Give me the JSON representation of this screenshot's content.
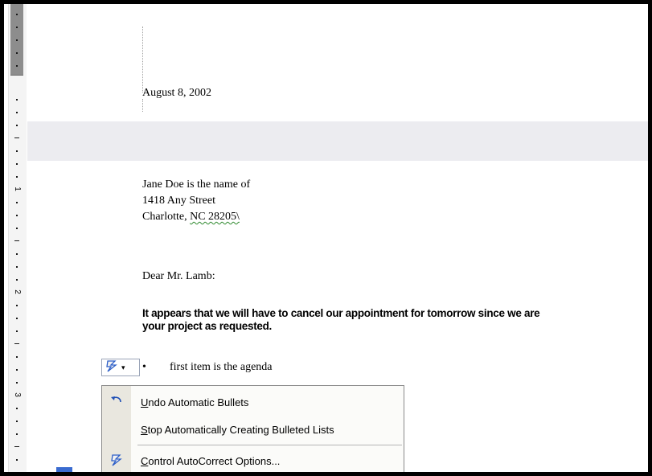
{
  "document": {
    "date": "August 8, 2002",
    "address": [
      "Jane Doe is the name of",
      "1418 Any Street",
      "Charlotte, NC  28205\\"
    ],
    "salutation": "Dear Mr. Lamb:",
    "paragraph_line1": "It appears that we will have to cancel our appointment for tomorrow since we are",
    "paragraph_line2": "your project as requested.",
    "bullet_text": "first item is the agenda",
    "bullet_glyph": "•"
  },
  "ruler": {
    "numbers": [
      "1",
      "2",
      "3"
    ]
  },
  "autocorrect_button": {
    "icon": "lightning-bolt-icon",
    "dropdown_icon": "▾"
  },
  "menu": {
    "items": [
      {
        "icon": "undo-icon",
        "accel": "U",
        "rest": "ndo Automatic Bullets"
      },
      {
        "icon": "",
        "accel": "S",
        "rest": "top Automatically Creating Bulleted Lists"
      },
      {
        "icon": "lightning-bolt-icon",
        "accel": "C",
        "rest": "ontrol AutoCorrect Options..."
      }
    ]
  },
  "colors": {
    "accent": "#3a6bd0",
    "grammar_squiggle": "#2f8a2f",
    "menu_gutter": "#e9e7df"
  }
}
